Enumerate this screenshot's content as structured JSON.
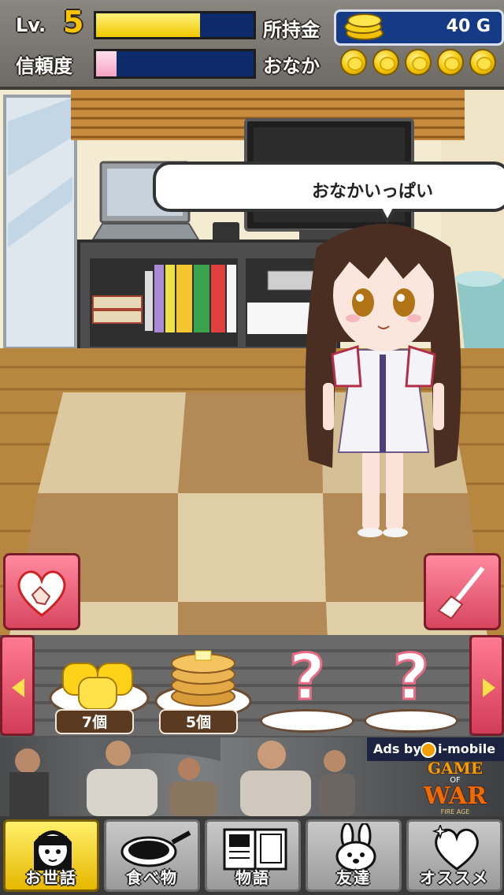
{
  "hud": {
    "level_label": "Lv.",
    "level_value": "5",
    "exp_fill": 0.66,
    "money_label": "所持金",
    "money_value": "40 G",
    "trust_label": "信頼度",
    "trust_fill": 0.13,
    "hunger_label": "おなか",
    "hunger_icons": 5
  },
  "room": {
    "speech_text": "おなかいっぱい"
  },
  "tray": {
    "items": [
      {
        "icon": "tamagoyaki-icon",
        "count": "7個"
      },
      {
        "icon": "pancake-icon",
        "count": "5個"
      },
      {
        "icon": "unknown-item-icon",
        "count": ""
      },
      {
        "icon": "unknown-item-icon",
        "count": ""
      }
    ]
  },
  "ad": {
    "ads_by": "Ads by",
    "provider": "i-mobile",
    "game_line1": "GAME",
    "game_of": "OF",
    "game_line2": "WAR",
    "game_sub": "FIRE AGE"
  },
  "nav": {
    "items": [
      {
        "label": "お世話",
        "icon": "girl-face-icon"
      },
      {
        "label": "食べ物",
        "icon": "frying-pan-icon"
      },
      {
        "label": "物語",
        "icon": "book-icon"
      },
      {
        "label": "友達",
        "icon": "rabbit-icon"
      },
      {
        "label": "オススメ",
        "icon": "heart-sparkle-icon"
      }
    ]
  },
  "colors": {
    "exp_bar": "#f5d600",
    "trust_bar": "#f7b6cf",
    "bar_bg": "#0d2a6b",
    "action_button": "#e8576d"
  }
}
